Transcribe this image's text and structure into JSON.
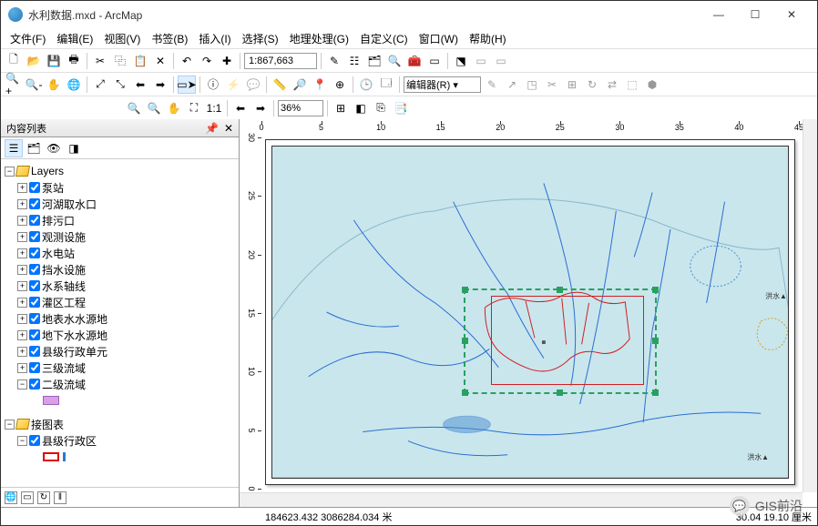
{
  "title": "水利数据.mxd - ArcMap",
  "menus": [
    "文件(F)",
    "编辑(E)",
    "视图(V)",
    "书签(B)",
    "插入(I)",
    "选择(S)",
    "地理处理(G)",
    "自定义(C)",
    "窗口(W)",
    "帮助(H)"
  ],
  "scale": "1:867,663",
  "zoom_pct": "36%",
  "editor_label": "编辑器(R) ▾",
  "toc": {
    "title": "内容列表",
    "group1": "Layers",
    "layers": [
      "泵站",
      "河湖取水口",
      "排污口",
      "观测设施",
      "水电站",
      "挡水设施",
      "水系轴线",
      "灌区工程",
      "地表水水源地",
      "地下水水源地",
      "县级行政单元",
      "三级流域",
      "二级流域"
    ],
    "group2": "接图表",
    "layers2": [
      "县级行政区"
    ]
  },
  "ruler_h": [
    "0",
    "5",
    "10",
    "15",
    "20",
    "25",
    "30",
    "35",
    "40",
    "45"
  ],
  "ruler_v": [
    "30",
    "25",
    "20",
    "15",
    "10",
    "5",
    "0"
  ],
  "status": {
    "coords": "184623.432  3086284.034 米",
    "pos": "30.04  19.10 厘米"
  },
  "watermark": "GIS前沿"
}
